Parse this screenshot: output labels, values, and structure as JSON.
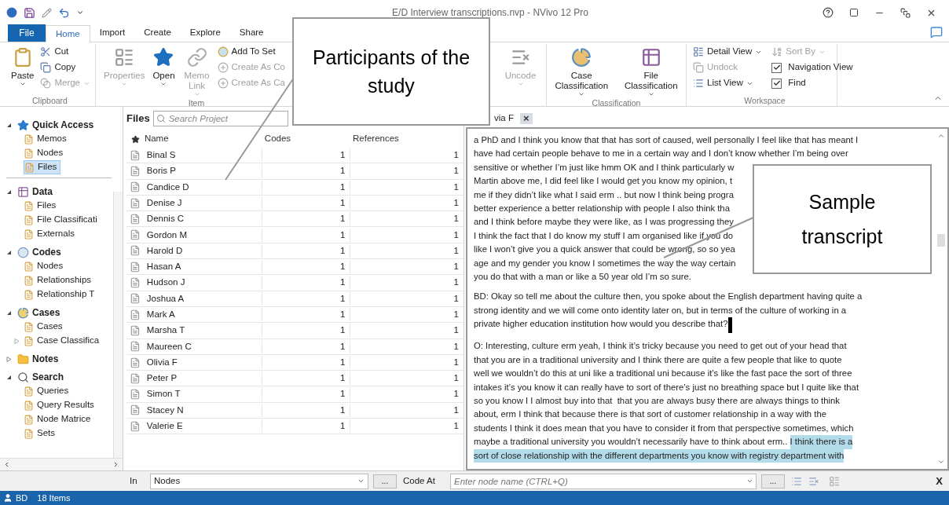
{
  "window": {
    "title": "E/D Interview transcriptions.nvp - NVivo 12 Pro"
  },
  "ribbon": {
    "tabs": [
      {
        "label": "File",
        "kind": "file",
        "selected": false
      },
      {
        "label": "Home",
        "kind": "tab",
        "selected": true
      },
      {
        "label": "Import",
        "kind": "tab",
        "selected": false
      },
      {
        "label": "Create",
        "kind": "tab",
        "selected": false
      },
      {
        "label": "Explore",
        "kind": "tab",
        "selected": false
      },
      {
        "label": "Share",
        "kind": "tab",
        "selected": false
      }
    ],
    "clipboard": {
      "label": "Clipboard",
      "paste": {
        "label": "Paste",
        "disabled": false
      },
      "cut": {
        "label": "Cut",
        "disabled": false
      },
      "copy": {
        "label": "Copy",
        "disabled": false
      },
      "merge": {
        "label": "Merge",
        "disabled": true
      }
    },
    "item": {
      "label": "Item",
      "properties": {
        "label": "Properties",
        "disabled": true
      },
      "open": {
        "label": "Open",
        "disabled": false
      },
      "memo_link": {
        "label": "Memo Link",
        "disabled": true
      },
      "add_to_set": {
        "label": "Add To Set",
        "disabled": false
      },
      "create_as_code": {
        "label": "Create As Co",
        "disabled": true
      },
      "create_as_case": {
        "label": "Create As Ca",
        "disabled": true
      }
    },
    "uncode": {
      "label": "Uncode",
      "disabled": true
    },
    "classification": {
      "label": "Classification",
      "case": {
        "label": "Case Classification",
        "disabled": false
      },
      "file": {
        "label": "File Classification",
        "disabled": false
      }
    },
    "workspace": {
      "label": "Workspace",
      "detail_view": {
        "label": "Detail View",
        "disabled": false
      },
      "sort_by": {
        "label": "Sort By",
        "disabled": true
      },
      "undock": {
        "label": "Undock",
        "disabled": true
      },
      "list_view": {
        "label": "List View",
        "disabled": false
      },
      "navigation_view": {
        "label": "Navigation View",
        "checked": true
      },
      "find": {
        "label": "Find",
        "checked": true
      }
    }
  },
  "navigation": {
    "sections": [
      {
        "label": "Quick Access",
        "expanded": true,
        "children": [
          {
            "label": "Memos",
            "kind": "leaf",
            "selected": false
          },
          {
            "label": "Nodes",
            "kind": "leaf",
            "selected": false
          },
          {
            "label": "Files",
            "kind": "leaf",
            "selected": true
          }
        ]
      },
      {
        "label": "Data",
        "expanded": true,
        "children": [
          {
            "label": "Files",
            "kind": "leaf",
            "selected": false
          },
          {
            "label": "File Classificati",
            "kind": "leaf",
            "selected": false
          },
          {
            "label": "Externals",
            "kind": "leaf",
            "selected": false
          }
        ]
      },
      {
        "label": "Codes",
        "expanded": true,
        "children": [
          {
            "label": "Nodes",
            "kind": "leaf",
            "selected": false
          },
          {
            "label": "Relationships",
            "kind": "leaf",
            "selected": false
          },
          {
            "label": "Relationship T",
            "kind": "leaf",
            "selected": false
          }
        ]
      },
      {
        "label": "Cases",
        "expanded": true,
        "children": [
          {
            "label": "Cases",
            "kind": "leaf",
            "selected": false
          },
          {
            "label": "Case Classifica",
            "kind": "branch",
            "expanded": false,
            "selected": false
          }
        ]
      },
      {
        "label": "Notes",
        "expanded": false
      },
      {
        "label": "Search",
        "expanded": true,
        "children": [
          {
            "label": "Queries",
            "kind": "leaf",
            "selected": false
          },
          {
            "label": "Query Results",
            "kind": "leaf",
            "selected": false
          },
          {
            "label": "Node Matrice",
            "kind": "leaf",
            "selected": false
          },
          {
            "label": "Sets",
            "kind": "leaf",
            "selected": false
          }
        ]
      }
    ]
  },
  "files": {
    "title": "Files",
    "search": {
      "placeholder": "Search Project"
    },
    "columns": [
      "Name",
      "Codes",
      "References"
    ],
    "rows": [
      {
        "name": "Binal S",
        "codes": "1",
        "references": "1"
      },
      {
        "name": "Boris P",
        "codes": "1",
        "references": "1"
      },
      {
        "name": "Candice D",
        "codes": "1",
        "references": "1"
      },
      {
        "name": "Denise J",
        "codes": "1",
        "references": "1"
      },
      {
        "name": "Dennis C",
        "codes": "1",
        "references": "1"
      },
      {
        "name": "Gordon M",
        "codes": "1",
        "references": "1"
      },
      {
        "name": "Harold D",
        "codes": "1",
        "references": "1"
      },
      {
        "name": "Hasan A",
        "codes": "1",
        "references": "1"
      },
      {
        "name": "Hudson J",
        "codes": "1",
        "references": "1"
      },
      {
        "name": "Joshua A",
        "codes": "1",
        "references": "1"
      },
      {
        "name": "Mark A",
        "codes": "1",
        "references": "1"
      },
      {
        "name": "Marsha T",
        "codes": "1",
        "references": "1"
      },
      {
        "name": "Maureen C",
        "codes": "1",
        "references": "1"
      },
      {
        "name": "Olivia F",
        "codes": "1",
        "references": "1"
      },
      {
        "name": "Peter P",
        "codes": "1",
        "references": "1"
      },
      {
        "name": "Simon T",
        "codes": "1",
        "references": "1"
      },
      {
        "name": "Stacey N",
        "codes": "1",
        "references": "1"
      },
      {
        "name": "Valerie E",
        "codes": "1",
        "references": "1"
      }
    ]
  },
  "document": {
    "tab": {
      "label": "via F",
      "close": "×"
    },
    "paragraphs": [
      {
        "lines": [
          [
            {
              "text": "a PhD and I think you know that that has sort of caused, well personally I feel like that has meant I",
              "highlighted": false
            }
          ],
          [
            {
              "text": "have had certain people behave to me in a certain way and I don’t know whether I’m being over",
              "highlighted": false
            }
          ],
          [
            {
              "text": "sensitive or whether I’m just like hmm OK and I think particularly w",
              "highlighted": false
            }
          ],
          [
            {
              "text": "Martin above me, I did feel like I would get you know my opinion, t",
              "highlighted": false
            }
          ],
          [
            {
              "text": "me if they didn’t like what I said erm .. but now I think being progra",
              "highlighted": false
            }
          ],
          [
            {
              "text": "better experience a better relationship with people I also think tha",
              "highlighted": false
            }
          ],
          [
            {
              "text": "and I think before maybe they were like, as I was progressing they",
              "highlighted": false
            }
          ],
          [
            {
              "text": "I think the fact that I do know my stuff I am organised like if you do",
              "highlighted": false
            }
          ],
          [
            {
              "text": "like I won’t give you a quick answer that could be wrong, so so yea",
              "highlighted": false
            }
          ],
          [
            {
              "text": "age and my gender you know I sometimes the way the way certain",
              "highlighted": false
            }
          ],
          [
            {
              "text": "you do that with a man or like a 50 year old I’m so sure.",
              "highlighted": false
            }
          ]
        ]
      },
      {
        "lines": [
          [
            {
              "text": "BD: Okay so tell me about the culture then, you spoke about the English department having quite a",
              "highlighted": false
            }
          ],
          [
            {
              "text": "strong identity and we will come onto identity later on, but in terms of the culture of working in a",
              "highlighted": false
            }
          ],
          [
            {
              "text": "private higher education institution how would you describe that?",
              "highlighted": false
            }
          ]
        ]
      },
      {
        "lines": [
          [
            {
              "text": "O: Interesting, culture erm yeah, I think it’s tricky because you need to get out of your head that",
              "highlighted": false
            }
          ],
          [
            {
              "text": "that you are in a traditional university and I think there are quite a few people that like to quote",
              "highlighted": false
            }
          ],
          [
            {
              "text": "well we wouldn’t do this at uni like a traditional uni because it’s like the fast pace the sort of three",
              "highlighted": false
            }
          ],
          [
            {
              "text": "intakes it’s you know it can really have to sort of there’s just no breathing space but I quite like that",
              "highlighted": false
            }
          ],
          [
            {
              "text": "so you know I I almost buy into that  that you are always busy there are always things to think",
              "highlighted": false
            }
          ],
          [
            {
              "text": "about, erm I think that because there is that sort of customer relationship in a way with the",
              "highlighted": false
            }
          ],
          [
            {
              "text": "students I think it does mean that you have to consider it from that perspective sometimes, which",
              "highlighted": false
            }
          ],
          [
            {
              "text": "maybe a traditional university you wouldn’t necessarily have to think about erm.. ",
              "highlighted": false
            },
            {
              "text": "I think there is a",
              "highlighted": true
            }
          ],
          [
            {
              "text": "sort of close relationship with the different departments you know with registry department with",
              "highlighted": true
            }
          ]
        ]
      }
    ]
  },
  "callouts": [
    {
      "text": "Participants of the study"
    },
    {
      "text": "Sample transcript"
    }
  ],
  "code_bar": {
    "in_label": "In",
    "in_value": "Nodes",
    "browse": "...",
    "code_at": "Code At",
    "node": {
      "placeholder": "Enter node name (CTRL+Q)"
    },
    "browse_node": "...",
    "close": "X"
  },
  "status_bar": {
    "user": "BD",
    "count": "18 Items"
  }
}
